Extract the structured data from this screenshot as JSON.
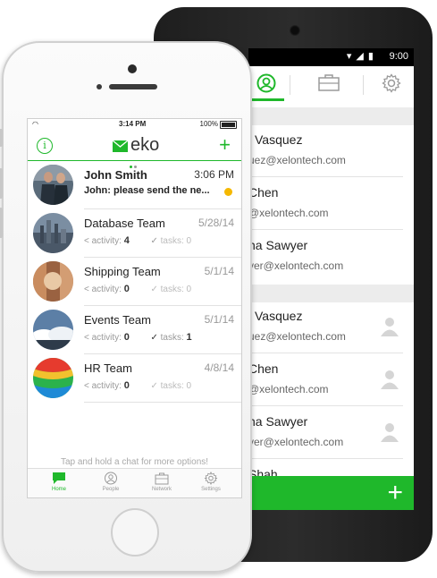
{
  "android": {
    "status_time": "9:00",
    "contacts": [
      {
        "name": "l Vasquez",
        "email": "uez@xelontech.com"
      },
      {
        "name": "Chen",
        "email": "@xelontech.com"
      },
      {
        "name": "na Sawyer",
        "email": "yer@xelontech.com"
      },
      {
        "name": "l Vasquez",
        "email": "uez@xelontech.com"
      },
      {
        "name": "Chen",
        "email": "@xelontech.com"
      },
      {
        "name": "na Sawyer",
        "email": "yer@xelontech.com"
      },
      {
        "name": "Shah",
        "email": ""
      }
    ],
    "add_label": "+"
  },
  "iphone": {
    "status": {
      "time": "3:14 PM",
      "battery": "100%"
    },
    "logo_text": "eko",
    "info_label": "i",
    "add_label": "+",
    "chats": [
      {
        "name": "John Smith",
        "date": "3:06 PM",
        "preview": "John: please send the ne...",
        "unread": true
      },
      {
        "name": "Database Team",
        "date": "5/28/14",
        "activity_label": "activity:",
        "activity": "4",
        "tasks_label": "tasks:",
        "tasks": "0"
      },
      {
        "name": "Shipping Team",
        "date": "5/1/14",
        "activity_label": "activity:",
        "activity": "0",
        "tasks_label": "tasks:",
        "tasks": "0"
      },
      {
        "name": "Events Team",
        "date": "5/1/14",
        "activity_label": "activity:",
        "activity": "0",
        "tasks_label": "tasks:",
        "tasks": "1"
      },
      {
        "name": "HR Team",
        "date": "4/8/14",
        "activity_label": "activity:",
        "activity": "0",
        "tasks_label": "tasks:",
        "tasks": "0"
      }
    ],
    "hint": "Tap and hold a chat for more options!",
    "tabs": [
      {
        "label": "Home",
        "icon": "chat-bubble-icon",
        "active": true
      },
      {
        "label": "People",
        "icon": "person-icon",
        "active": false
      },
      {
        "label": "Network",
        "icon": "briefcase-icon",
        "active": false
      },
      {
        "label": "Settings",
        "icon": "gear-icon",
        "active": false
      }
    ]
  },
  "colors": {
    "accent": "#1fb82b",
    "unread": "#f5b800"
  }
}
